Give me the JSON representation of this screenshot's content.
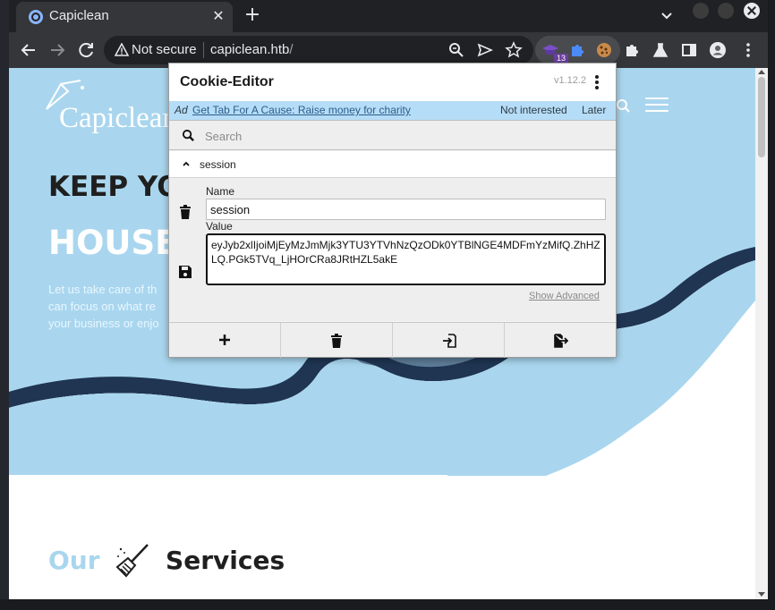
{
  "browser": {
    "tab_title": "Capiclean",
    "tab_close": "✕",
    "new_tab": "+",
    "omnibox": {
      "security_label": "Not secure",
      "host": "capiclean.htb",
      "path": "/"
    },
    "extension_badge": "13"
  },
  "page": {
    "logo_text": "Capiclean",
    "hero_line1": "KEEP YOU",
    "hero_line2": "HOUSE",
    "hero_paragraph": "Let us take care of th can focus on what re your business or enjo",
    "services_prefix": "Our",
    "services_word": "Services",
    "colors": {
      "hero_blue": "#a9d6ee",
      "wave_shadow": "#1f3552"
    }
  },
  "cookie_editor": {
    "title": "Cookie-Editor",
    "version": "v1.12.2",
    "ad": {
      "tag": "Ad",
      "link": "Get Tab For A Cause: Raise money for charity",
      "not_interested": "Not interested",
      "later": "Later"
    },
    "search_placeholder": "Search",
    "cookie_name": "session",
    "name_label": "Name",
    "name_value": "session",
    "value_label": "Value",
    "value": "eyJyb2xlIjoiMjEyMzJmMjk3YTU3YTVhNzQzODk0YTBlNGE4MDFmYzMifQ.ZhHZLQ.PGk5TVq_LjHOrCRa8JRtHZL5akE",
    "show_advanced": "Show Advanced",
    "actions": [
      "add-icon",
      "trash-icon",
      "import-icon",
      "export-icon"
    ]
  }
}
